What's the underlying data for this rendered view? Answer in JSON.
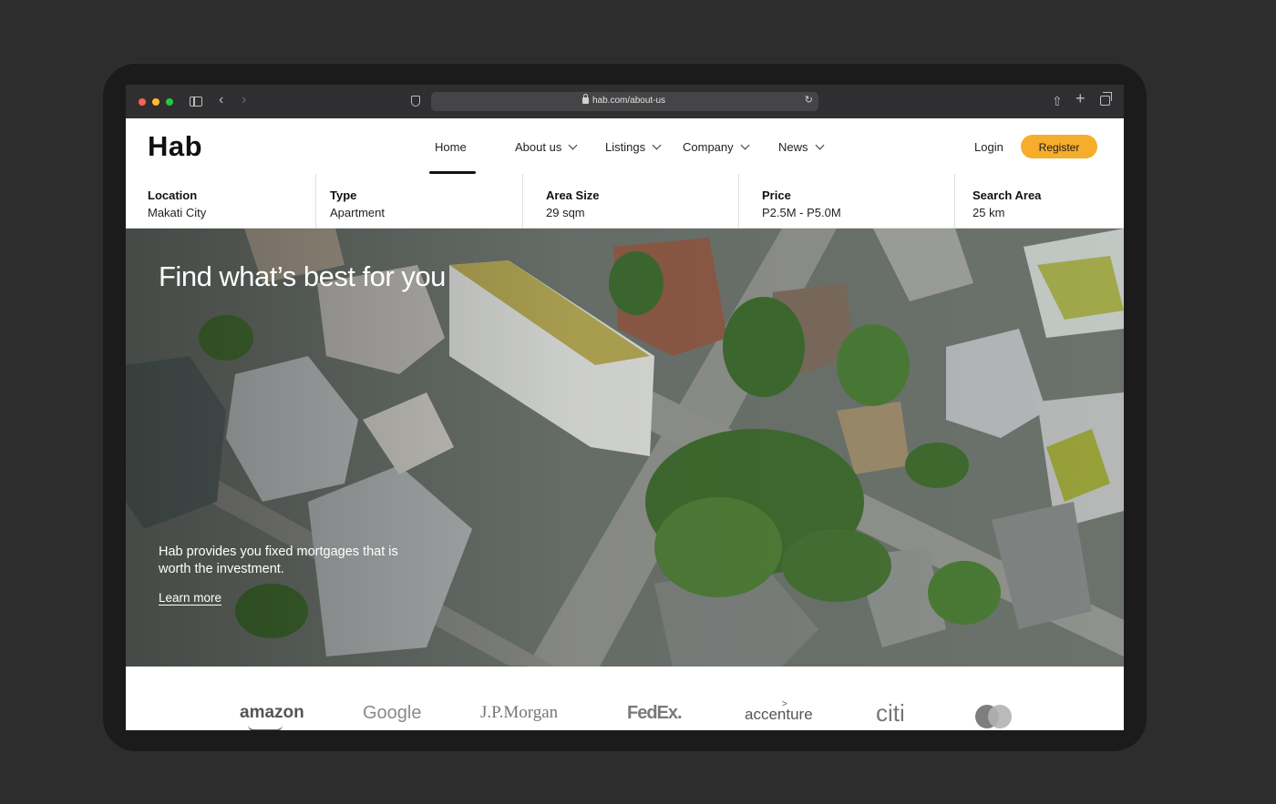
{
  "browser": {
    "url": "hab.com/about-us"
  },
  "header": {
    "logo": "Hab",
    "nav": [
      {
        "label": "Home",
        "has_dropdown": false,
        "active": true
      },
      {
        "label": "About us",
        "has_dropdown": true
      },
      {
        "label": "Listings",
        "has_dropdown": true
      },
      {
        "label": "Company",
        "has_dropdown": true
      },
      {
        "label": "News",
        "has_dropdown": true
      }
    ],
    "login_label": "Login",
    "register_label": "Register",
    "accent_color": "#f6ad2b"
  },
  "filters": [
    {
      "label": "Location",
      "value": "Makati City"
    },
    {
      "label": "Type",
      "value": "Apartment"
    },
    {
      "label": "Area Size",
      "value": "29 sqm"
    },
    {
      "label": "Price",
      "value": "P2.5M - P5.0M"
    },
    {
      "label": "Search Area",
      "value": "25 km"
    }
  ],
  "hero": {
    "title": "Find what’s best for you",
    "description": "Hab provides you fixed mortgages that is worth the investment.",
    "link_label": "Learn more",
    "image": "aerial-city-photo"
  },
  "brands": [
    "amazon",
    "Google",
    "J.P.Morgan",
    "FedEx.",
    "accenture",
    "citi",
    "mastercard-logo"
  ]
}
